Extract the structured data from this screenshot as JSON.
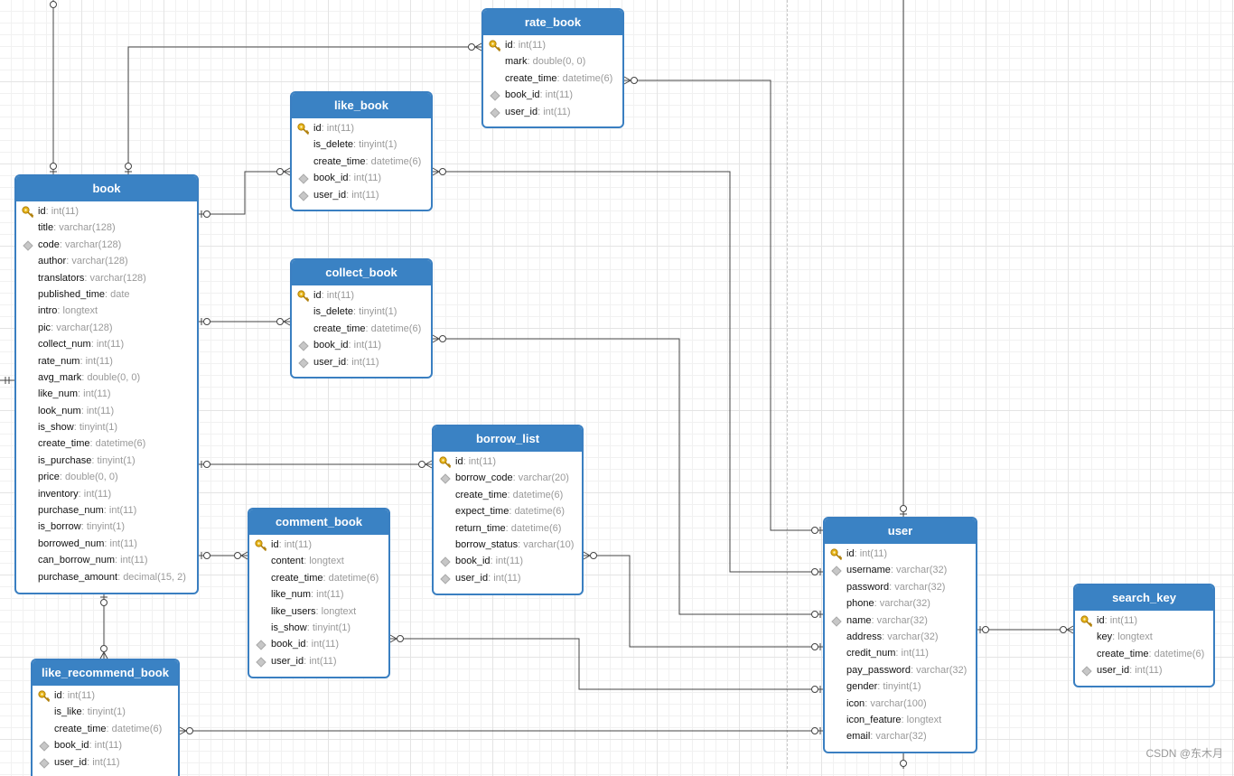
{
  "tables": {
    "book": {
      "name": "book",
      "columns": [
        {
          "name": "id",
          "type": "int(11)",
          "key": "pk"
        },
        {
          "name": "title",
          "type": "varchar(128)",
          "key": "none"
        },
        {
          "name": "code",
          "type": "varchar(128)",
          "key": "idx"
        },
        {
          "name": "author",
          "type": "varchar(128)",
          "key": "none"
        },
        {
          "name": "translators",
          "type": "varchar(128)",
          "key": "none"
        },
        {
          "name": "published_time",
          "type": "date",
          "key": "none"
        },
        {
          "name": "intro",
          "type": "longtext",
          "key": "none"
        },
        {
          "name": "pic",
          "type": "varchar(128)",
          "key": "none"
        },
        {
          "name": "collect_num",
          "type": "int(11)",
          "key": "none"
        },
        {
          "name": "rate_num",
          "type": "int(11)",
          "key": "none"
        },
        {
          "name": "avg_mark",
          "type": "double(0, 0)",
          "key": "none"
        },
        {
          "name": "like_num",
          "type": "int(11)",
          "key": "none"
        },
        {
          "name": "look_num",
          "type": "int(11)",
          "key": "none"
        },
        {
          "name": "is_show",
          "type": "tinyint(1)",
          "key": "none"
        },
        {
          "name": "create_time",
          "type": "datetime(6)",
          "key": "none"
        },
        {
          "name": "is_purchase",
          "type": "tinyint(1)",
          "key": "none"
        },
        {
          "name": "price",
          "type": "double(0, 0)",
          "key": "none"
        },
        {
          "name": "inventory",
          "type": "int(11)",
          "key": "none"
        },
        {
          "name": "purchase_num",
          "type": "int(11)",
          "key": "none"
        },
        {
          "name": "is_borrow",
          "type": "tinyint(1)",
          "key": "none"
        },
        {
          "name": "borrowed_num",
          "type": "int(11)",
          "key": "none"
        },
        {
          "name": "can_borrow_num",
          "type": "int(11)",
          "key": "none"
        },
        {
          "name": "purchase_amount",
          "type": "decimal(15, 2)",
          "key": "none"
        }
      ]
    },
    "rate_book": {
      "name": "rate_book",
      "columns": [
        {
          "name": "id",
          "type": "int(11)",
          "key": "pk"
        },
        {
          "name": "mark",
          "type": "double(0, 0)",
          "key": "none"
        },
        {
          "name": "create_time",
          "type": "datetime(6)",
          "key": "none"
        },
        {
          "name": "book_id",
          "type": "int(11)",
          "key": "idx"
        },
        {
          "name": "user_id",
          "type": "int(11)",
          "key": "idx"
        }
      ]
    },
    "like_book": {
      "name": "like_book",
      "columns": [
        {
          "name": "id",
          "type": "int(11)",
          "key": "pk"
        },
        {
          "name": "is_delete",
          "type": "tinyint(1)",
          "key": "none"
        },
        {
          "name": "create_time",
          "type": "datetime(6)",
          "key": "none"
        },
        {
          "name": "book_id",
          "type": "int(11)",
          "key": "idx"
        },
        {
          "name": "user_id",
          "type": "int(11)",
          "key": "idx"
        }
      ]
    },
    "collect_book": {
      "name": "collect_book",
      "columns": [
        {
          "name": "id",
          "type": "int(11)",
          "key": "pk"
        },
        {
          "name": "is_delete",
          "type": "tinyint(1)",
          "key": "none"
        },
        {
          "name": "create_time",
          "type": "datetime(6)",
          "key": "none"
        },
        {
          "name": "book_id",
          "type": "int(11)",
          "key": "idx"
        },
        {
          "name": "user_id",
          "type": "int(11)",
          "key": "idx"
        }
      ]
    },
    "borrow_list": {
      "name": "borrow_list",
      "columns": [
        {
          "name": "id",
          "type": "int(11)",
          "key": "pk"
        },
        {
          "name": "borrow_code",
          "type": "varchar(20)",
          "key": "idx"
        },
        {
          "name": "create_time",
          "type": "datetime(6)",
          "key": "none"
        },
        {
          "name": "expect_time",
          "type": "datetime(6)",
          "key": "none"
        },
        {
          "name": "return_time",
          "type": "datetime(6)",
          "key": "none"
        },
        {
          "name": "borrow_status",
          "type": "varchar(10)",
          "key": "none"
        },
        {
          "name": "book_id",
          "type": "int(11)",
          "key": "idx"
        },
        {
          "name": "user_id",
          "type": "int(11)",
          "key": "idx"
        }
      ]
    },
    "comment_book": {
      "name": "comment_book",
      "columns": [
        {
          "name": "id",
          "type": "int(11)",
          "key": "pk"
        },
        {
          "name": "content",
          "type": "longtext",
          "key": "none"
        },
        {
          "name": "create_time",
          "type": "datetime(6)",
          "key": "none"
        },
        {
          "name": "like_num",
          "type": "int(11)",
          "key": "none"
        },
        {
          "name": "like_users",
          "type": "longtext",
          "key": "none"
        },
        {
          "name": "is_show",
          "type": "tinyint(1)",
          "key": "none"
        },
        {
          "name": "book_id",
          "type": "int(11)",
          "key": "idx"
        },
        {
          "name": "user_id",
          "type": "int(11)",
          "key": "idx"
        }
      ]
    },
    "like_recommend_book": {
      "name": "like_recommend_book",
      "columns": [
        {
          "name": "id",
          "type": "int(11)",
          "key": "pk"
        },
        {
          "name": "is_like",
          "type": "tinyint(1)",
          "key": "none"
        },
        {
          "name": "create_time",
          "type": "datetime(6)",
          "key": "none"
        },
        {
          "name": "book_id",
          "type": "int(11)",
          "key": "idx"
        },
        {
          "name": "user_id",
          "type": "int(11)",
          "key": "idx"
        }
      ]
    },
    "user": {
      "name": "user",
      "columns": [
        {
          "name": "id",
          "type": "int(11)",
          "key": "pk"
        },
        {
          "name": "username",
          "type": "varchar(32)",
          "key": "idx"
        },
        {
          "name": "password",
          "type": "varchar(32)",
          "key": "none"
        },
        {
          "name": "phone",
          "type": "varchar(32)",
          "key": "none"
        },
        {
          "name": "name",
          "type": "varchar(32)",
          "key": "idx"
        },
        {
          "name": "address",
          "type": "varchar(32)",
          "key": "none"
        },
        {
          "name": "credit_num",
          "type": "int(11)",
          "key": "none"
        },
        {
          "name": "pay_password",
          "type": "varchar(32)",
          "key": "none"
        },
        {
          "name": "gender",
          "type": "tinyint(1)",
          "key": "none"
        },
        {
          "name": "icon",
          "type": "varchar(100)",
          "key": "none"
        },
        {
          "name": "icon_feature",
          "type": "longtext",
          "key": "none"
        },
        {
          "name": "email",
          "type": "varchar(32)",
          "key": "none"
        }
      ]
    },
    "search_key": {
      "name": "search_key",
      "columns": [
        {
          "name": "id",
          "type": "int(11)",
          "key": "pk"
        },
        {
          "name": "key",
          "type": "longtext",
          "key": "none"
        },
        {
          "name": "create_time",
          "type": "datetime(6)",
          "key": "none"
        },
        {
          "name": "user_id",
          "type": "int(11)",
          "key": "idx"
        }
      ]
    }
  },
  "watermark": "CSDN @东木月",
  "colors": {
    "header": "#3a82c4",
    "border": "#3a7fc1",
    "line": "#444444",
    "type_text": "#999999"
  }
}
